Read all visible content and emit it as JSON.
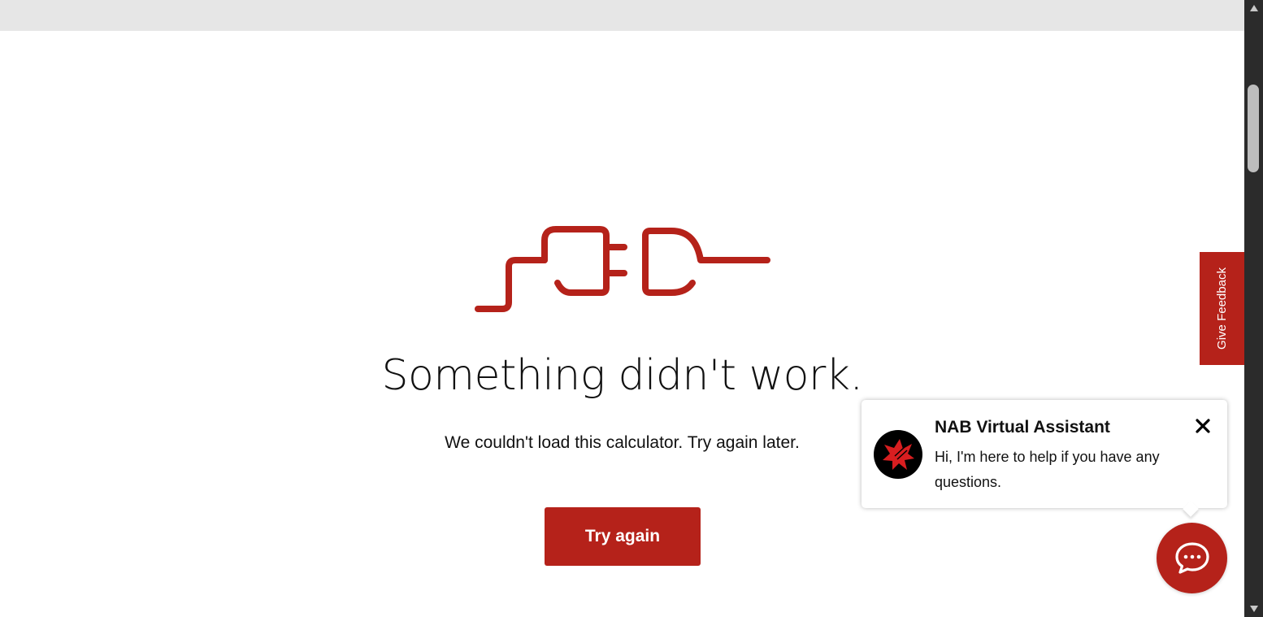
{
  "error": {
    "title": "Something didn't work.",
    "message": "We couldn't load this calculator. Try again later.",
    "button_label": "Try again",
    "illustration_icon": "unplugged-cable-icon"
  },
  "feedback": {
    "label": "Give Feedback"
  },
  "assistant": {
    "title": "NAB Virtual Assistant",
    "message": "Hi, I'm here to help if you have any questions.",
    "avatar_icon": "nab-star-logo-icon",
    "close_icon": "close-icon",
    "launcher_icon": "chat-bubble-icon"
  },
  "colors": {
    "brand_red": "#b5221a",
    "top_bar": "#e6e6e6",
    "scrollbar": "#2b2b2b"
  }
}
